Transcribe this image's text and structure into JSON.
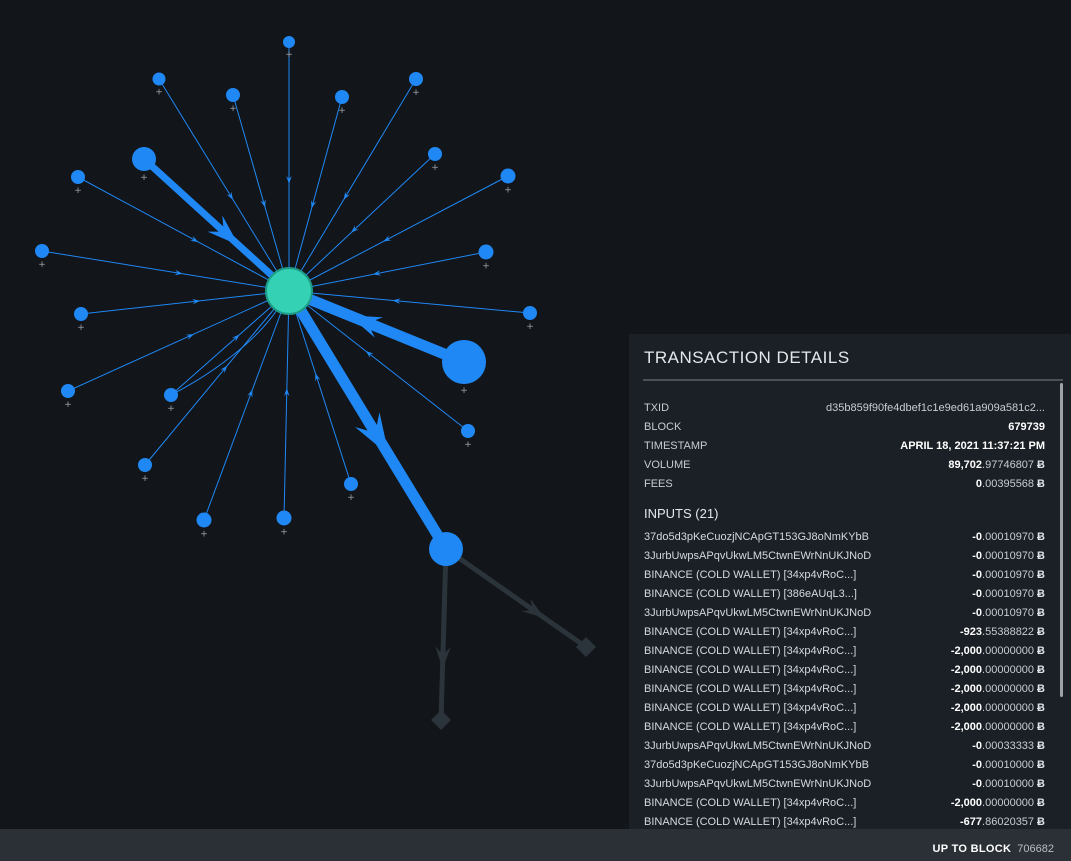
{
  "panel": {
    "title": "TRANSACTION DETAILS",
    "meta": [
      {
        "label": "TXID",
        "value": "d35b859f90fe4dbef1c1e9ed61a909a581c2...",
        "kind": "plain"
      },
      {
        "label": "BLOCK",
        "value": "679739",
        "kind": "bold"
      },
      {
        "label": "TIMESTAMP",
        "value": "APRIL 18, 2021 11:37:21 PM",
        "kind": "bold"
      },
      {
        "label": "VOLUME",
        "strong": "89,702",
        "weak": ".97746807",
        "unit": "Ƀ",
        "kind": "amount"
      },
      {
        "label": "FEES",
        "strong": "0",
        "weak": ".00395568",
        "unit": "Ƀ",
        "kind": "amount"
      }
    ],
    "inputs_heading": "INPUTS (21)",
    "inputs": [
      {
        "address": "37do5d3pKeCuozjNCApGT153GJ8oNmKYbB",
        "strong": "-0",
        "weak": ".00010970",
        "unit": "Ƀ"
      },
      {
        "address": "3JurbUwpsAPqvUkwLM5CtwnEWrNnUKJNoD",
        "strong": "-0",
        "weak": ".00010970",
        "unit": "Ƀ"
      },
      {
        "address": "BINANCE (COLD WALLET) [34xp4vRoC...]",
        "strong": "-0",
        "weak": ".00010970",
        "unit": "Ƀ"
      },
      {
        "address": "BINANCE (COLD WALLET) [386eAUqL3...]",
        "strong": "-0",
        "weak": ".00010970",
        "unit": "Ƀ"
      },
      {
        "address": "3JurbUwpsAPqvUkwLM5CtwnEWrNnUKJNoD",
        "strong": "-0",
        "weak": ".00010970",
        "unit": "Ƀ"
      },
      {
        "address": "BINANCE (COLD WALLET) [34xp4vRoC...]",
        "strong": "-923",
        "weak": ".55388822",
        "unit": "Ƀ"
      },
      {
        "address": "BINANCE (COLD WALLET) [34xp4vRoC...]",
        "strong": "-2,000",
        "weak": ".00000000",
        "unit": "Ƀ"
      },
      {
        "address": "BINANCE (COLD WALLET) [34xp4vRoC...]",
        "strong": "-2,000",
        "weak": ".00000000",
        "unit": "Ƀ"
      },
      {
        "address": "BINANCE (COLD WALLET) [34xp4vRoC...]",
        "strong": "-2,000",
        "weak": ".00000000",
        "unit": "Ƀ"
      },
      {
        "address": "BINANCE (COLD WALLET) [34xp4vRoC...]",
        "strong": "-2,000",
        "weak": ".00000000",
        "unit": "Ƀ"
      },
      {
        "address": "BINANCE (COLD WALLET) [34xp4vRoC...]",
        "strong": "-2,000",
        "weak": ".00000000",
        "unit": "Ƀ"
      },
      {
        "address": "3JurbUwpsAPqvUkwLM5CtwnEWrNnUKJNoD",
        "strong": "-0",
        "weak": ".00033333",
        "unit": "Ƀ"
      },
      {
        "address": "37do5d3pKeCuozjNCApGT153GJ8oNmKYbB",
        "strong": "-0",
        "weak": ".00010000",
        "unit": "Ƀ"
      },
      {
        "address": "3JurbUwpsAPqvUkwLM5CtwnEWrNnUKJNoD",
        "strong": "-0",
        "weak": ".00010000",
        "unit": "Ƀ"
      },
      {
        "address": "BINANCE (COLD WALLET) [34xp4vRoC...]",
        "strong": "-2,000",
        "weak": ".00000000",
        "unit": "Ƀ"
      },
      {
        "address": "BINANCE (COLD WALLET) [34xp4vRoC...]",
        "strong": "-677",
        "weak": ".86020357",
        "unit": "Ƀ"
      }
    ]
  },
  "footer": {
    "label": "UP TO BLOCK",
    "value": "706682"
  },
  "graph": {
    "expand_glyph": "+",
    "colors": {
      "node": "#1f88f5",
      "center_node": "#34d1b5",
      "edge": "#1f88f5",
      "output_edge": "#2c343b"
    }
  }
}
